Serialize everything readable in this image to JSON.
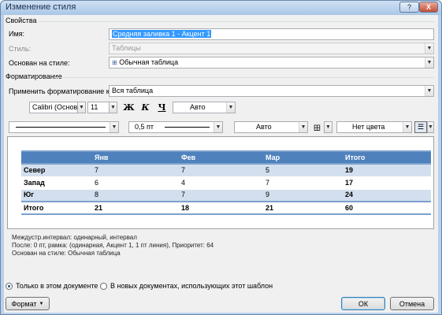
{
  "window": {
    "title": "Изменение стиля",
    "help": "?",
    "close": "X"
  },
  "properties": {
    "heading": "Свойства",
    "name_label": "Имя:",
    "name_value": "Средняя заливка 1 - Акцент 1",
    "style_type_label": "Стиль:",
    "style_type_value": "Таблицы",
    "based_on_label": "Основан на стиле:",
    "based_on_value": "Обычная таблица"
  },
  "formatting": {
    "heading": "Форматирование",
    "apply_to_label": "Применить форматирование к:",
    "apply_to_value": "Вся таблица",
    "font_name": "Calibri (Основной тек",
    "font_size": "11",
    "bold": "Ж",
    "italic": "К",
    "underline": "Ч",
    "font_color": "Авто",
    "border_width": "0,5 пт",
    "border_color": "Авто",
    "shading": "Нет цвета"
  },
  "preview": {
    "headers": [
      "",
      "Янв",
      "Фев",
      "Мар",
      "Итого"
    ],
    "rows": [
      [
        "Север",
        "7",
        "7",
        "5",
        "19"
      ],
      [
        "Запад",
        "6",
        "4",
        "7",
        "17"
      ],
      [
        "Юг",
        "8",
        "7",
        "9",
        "24"
      ],
      [
        "Итого",
        "21",
        "18",
        "21",
        "60"
      ]
    ]
  },
  "description": {
    "line1": "Междустр.интервал:  одинарный, интервал",
    "line2": "После:  0 пт, рамка: (одинарная, Акцент 1,  1 пт линия), Приоритет: 64",
    "line3": "Основан на стиле: Обычная таблица"
  },
  "scope": {
    "this_document": "Только в этом документе",
    "new_documents": "В новых документах, использующих этот шаблон",
    "selected": "this_document"
  },
  "buttons": {
    "format": "Формат",
    "ok": "ОК",
    "cancel": "Отмена"
  },
  "colors": {
    "header_fill": "#4f81bd",
    "band_fill": "#d3dfee",
    "accent_line": "#7ba0cd"
  }
}
